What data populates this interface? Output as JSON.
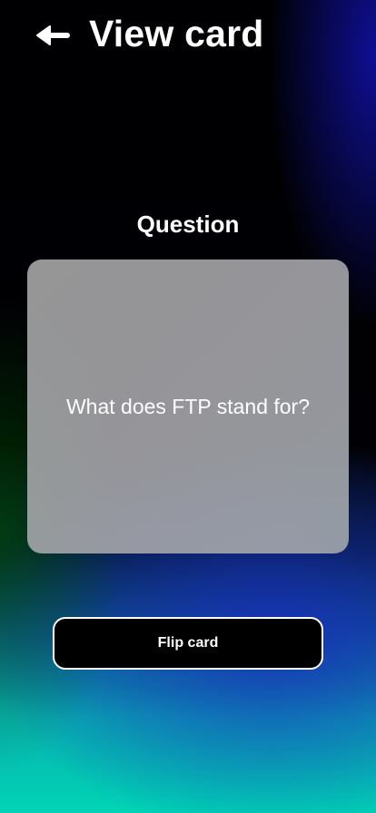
{
  "header": {
    "back_icon": "arrow-left-icon",
    "title": "View card"
  },
  "card": {
    "side_label": "Question",
    "text": "What does FTP stand for?"
  },
  "actions": {
    "flip_label": "Flip card"
  },
  "colors": {
    "button_background": "#000000",
    "button_border": "#ffffff",
    "card_background": "#a8a8ab",
    "text": "#ffffff"
  }
}
